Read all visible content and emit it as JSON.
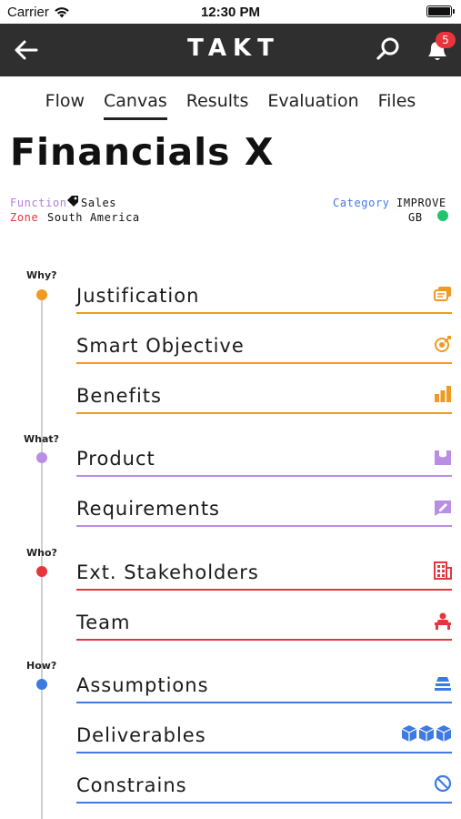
{
  "status_bar": {
    "carrier": "Carrier",
    "time": "12:30 PM"
  },
  "app_bar": {
    "title": "TAKT",
    "notification_count": "5"
  },
  "tabs": [
    {
      "label": "Flow",
      "active": false
    },
    {
      "label": "Canvas",
      "active": true
    },
    {
      "label": "Results",
      "active": false
    },
    {
      "label": "Evaluation",
      "active": false
    },
    {
      "label": "Files",
      "active": false
    }
  ],
  "page": {
    "title": "Financials X"
  },
  "meta": {
    "function_key": "Function",
    "function_value": "Sales",
    "zone_key": "Zone",
    "zone_value": "South America",
    "category_key": "Category",
    "category_value": "IMPROVE",
    "region_value": "GB"
  },
  "colors": {
    "why": "#f09a21",
    "what": "#b98ee4",
    "who": "#e8353d",
    "how": "#3f7ae0",
    "appbar": "#2f2f2f",
    "status_ok": "#20c46f"
  },
  "sections": [
    {
      "label": "Why?",
      "color": "#f09a21",
      "items": [
        {
          "label": "Justification",
          "icon": "chat-bubbles-icon"
        },
        {
          "label": "Smart Objective",
          "icon": "target-icon"
        },
        {
          "label": "Benefits",
          "icon": "bar-chart-icon"
        }
      ]
    },
    {
      "label": "What?",
      "color": "#b98ee4",
      "items": [
        {
          "label": "Product",
          "icon": "product-box-icon"
        },
        {
          "label": "Requirements",
          "icon": "edit-note-icon"
        }
      ]
    },
    {
      "label": "Who?",
      "color": "#e8353d",
      "items": [
        {
          "label": "Ext. Stakeholders",
          "icon": "building-icon"
        },
        {
          "label": "Team",
          "icon": "team-desk-icon"
        }
      ]
    },
    {
      "label": "How?",
      "color": "#3f7ae0",
      "items": [
        {
          "label": "Assumptions",
          "icon": "stacked-layers-icon"
        },
        {
          "label": "Deliverables",
          "icon": "boxes-icon"
        },
        {
          "label": "Constrains",
          "icon": "no-entry-icon"
        }
      ]
    }
  ]
}
